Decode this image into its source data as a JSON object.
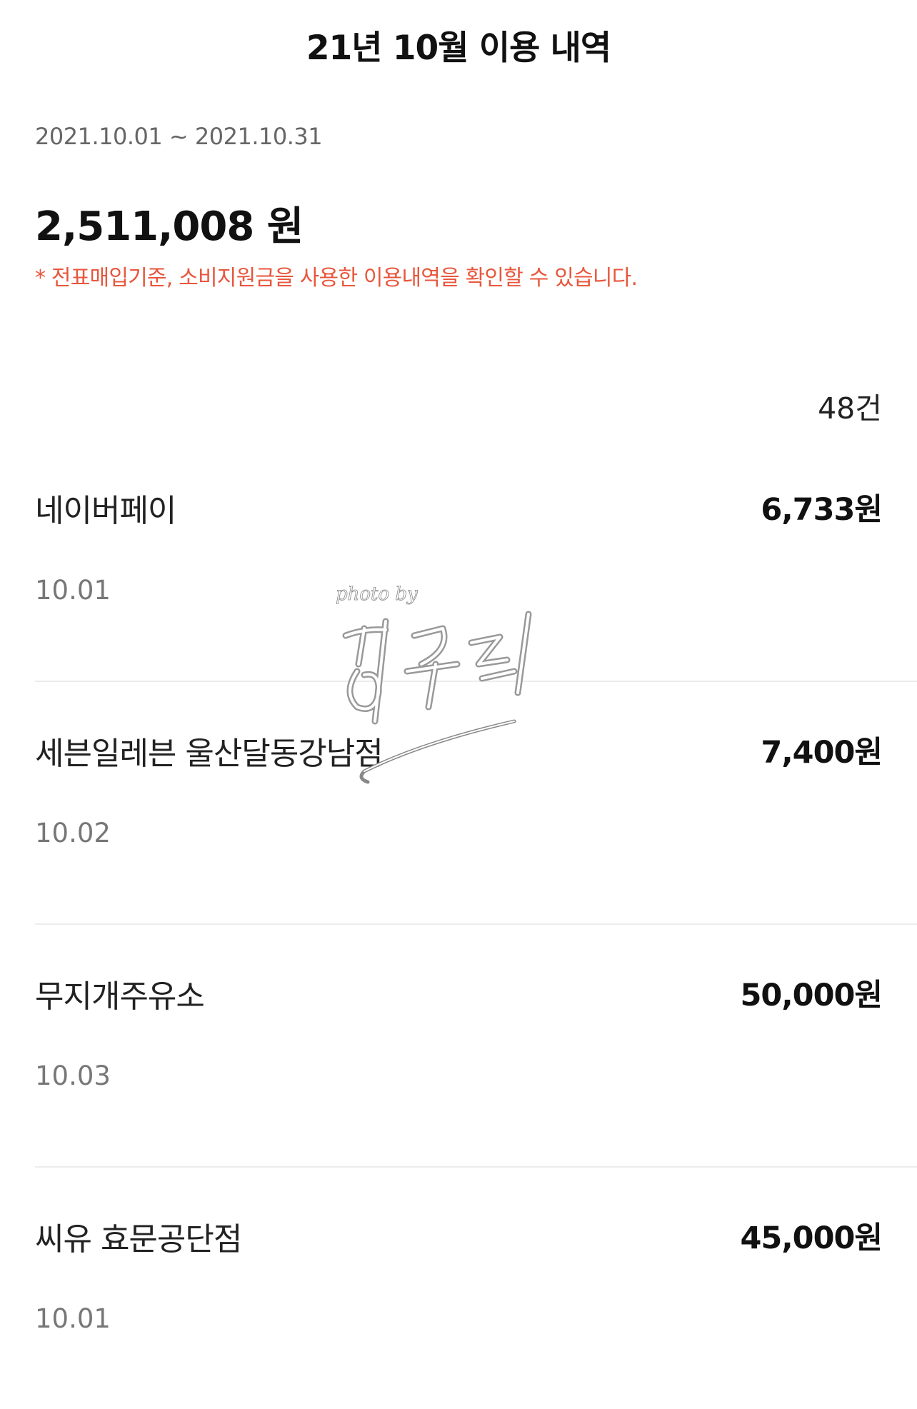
{
  "header": {
    "title": "21년 10월 이용 내역"
  },
  "summary": {
    "period": "2021.10.01 ~ 2021.10.31",
    "total": "2,511,008 원",
    "notice": "* 전표매입기준, 소비지원금을 사용한 이용내역을 확인할 수 있습니다.",
    "count": "48건"
  },
  "transactions": [
    {
      "merchant": "네이버페이",
      "amount": "6,733원",
      "date": "10.01"
    },
    {
      "merchant": "세븐일레븐 울산달동강남점",
      "amount": "7,400원",
      "date": "10.02"
    },
    {
      "merchant": "무지개주유소",
      "amount": "50,000원",
      "date": "10.03"
    },
    {
      "merchant": "씨유 효문공단점",
      "amount": "45,000원",
      "date": "10.01"
    }
  ],
  "watermark": {
    "text": "photo by"
  },
  "colors": {
    "notice": "#e8573d",
    "divider": "#ececec"
  }
}
